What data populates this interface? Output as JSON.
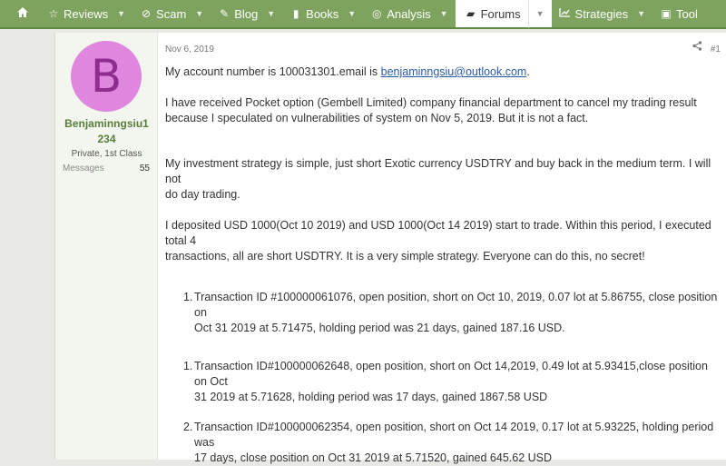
{
  "nav": {
    "items": [
      {
        "label": "",
        "icon": "home-icon"
      },
      {
        "label": "Reviews",
        "icon": "star-icon"
      },
      {
        "label": "Scam",
        "icon": "ban-icon"
      },
      {
        "label": "Blog",
        "icon": "pencil-icon"
      },
      {
        "label": "Books",
        "icon": "book-icon"
      },
      {
        "label": "Analysis",
        "icon": "podcast-icon"
      },
      {
        "label": "Forums",
        "icon": "comments-icon"
      },
      {
        "label": "Strategies",
        "icon": "chart-icon"
      },
      {
        "label": "Tool",
        "icon": "toolbox-icon"
      }
    ],
    "active": "Forums"
  },
  "user": {
    "avatar_letter": "B",
    "avatar_color": "#df86df",
    "name_line1": "Benjaminngsiu1",
    "name_line2": "234",
    "title": "Private, 1st Class",
    "stat_label": "Messages",
    "stat_value": "55"
  },
  "post": {
    "date": "Nov 6, 2019",
    "number": "#1",
    "account_prefix": "My account number is 100031301.email is ",
    "email": "benjaminngsiu@outlook.com",
    "account_suffix": ".",
    "para1_l1": "I have received Pocket option (Gembell Limited) company financial department to cancel my trading result",
    "para1_l2": "because I speculated on vulnerabilities of system on Nov 5, 2019. But it is not a fact.",
    "para2_l1": "My investment strategy is simple, just short Exotic currency USDTRY and buy back in the medium term. I will not",
    "para2_l2": "do day trading.",
    "para3_l1": "I deposited USD 1000(Oct 10 2019) and USD 1000(Oct 14 2019) start to trade. Within this period, I executed total 4",
    "para3_l2": "transactions, all are short USDTRY. It is a very simple strategy. Everyone can do this, no secret!",
    "list": [
      {
        "num": "1.",
        "l1": "Transaction ID #100000061076, open position, short on Oct 10, 2019, 0.07 lot at 5.86755, close position on",
        "l2": "Oct 31 2019 at 5.71475, holding period was 21 days, gained 187.16 USD."
      },
      {
        "num": "1.",
        "l1": "Transaction ID#100000062648, open position, short on Oct 14,2019, 0.49 lot at 5.93415,close position on Oct",
        "l2": "31 2019 at 5.71628, holding period was 17 days, gained 1867.58 USD"
      },
      {
        "num": "2.",
        "l1": "Transaction ID#100000062354, open position, short on Oct 14 2019, 0.17 lot at 5.93225, holding period was",
        "l2": "17 days, close position on Oct 31 2019 at 5.71520, gained 645.62 USD"
      }
    ]
  }
}
